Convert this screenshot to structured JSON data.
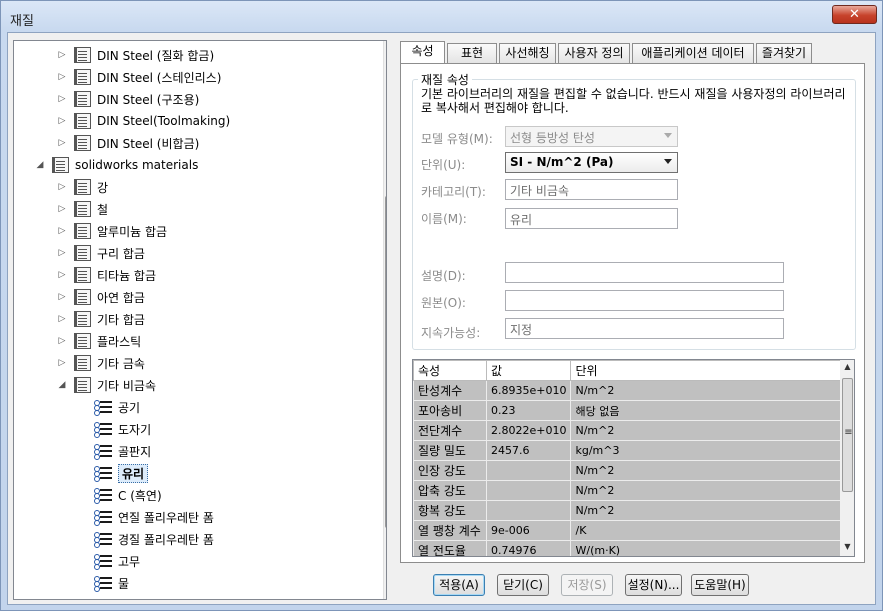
{
  "window": {
    "title": "재질",
    "close_glyph": "✕"
  },
  "tree": {
    "items": [
      {
        "label": "DIN Steel (질화 합금)",
        "kind": "folder",
        "expanded": false
      },
      {
        "label": "DIN Steel (스테인리스)",
        "kind": "folder",
        "expanded": false
      },
      {
        "label": "DIN Steel (구조용)",
        "kind": "folder",
        "expanded": false
      },
      {
        "label": "DIN Steel(Toolmaking)",
        "kind": "folder",
        "expanded": false
      },
      {
        "label": "DIN Steel (비합금)",
        "kind": "folder",
        "expanded": false
      },
      {
        "label": "solidworks materials",
        "kind": "library",
        "expanded": true
      },
      {
        "label": "강",
        "kind": "folder",
        "expanded": false
      },
      {
        "label": "철",
        "kind": "folder",
        "expanded": false
      },
      {
        "label": "알루미늄 합금",
        "kind": "folder",
        "expanded": false
      },
      {
        "label": "구리 합금",
        "kind": "folder",
        "expanded": false
      },
      {
        "label": "티타늄 합금",
        "kind": "folder",
        "expanded": false
      },
      {
        "label": "아연 합금",
        "kind": "folder",
        "expanded": false
      },
      {
        "label": "기타 합금",
        "kind": "folder",
        "expanded": false
      },
      {
        "label": "플라스틱",
        "kind": "folder",
        "expanded": false
      },
      {
        "label": "기타 금속",
        "kind": "folder",
        "expanded": false
      },
      {
        "label": "기타 비금속",
        "kind": "folder",
        "expanded": true
      },
      {
        "label": "공기",
        "kind": "material"
      },
      {
        "label": "도자기",
        "kind": "material"
      },
      {
        "label": "골판지",
        "kind": "material"
      },
      {
        "label": "유리",
        "kind": "material",
        "selected": true
      },
      {
        "label": "C (흑연)",
        "kind": "material"
      },
      {
        "label": "연질 폴리우레탄 폼",
        "kind": "material"
      },
      {
        "label": "경질 폴리우레탄 폼",
        "kind": "material"
      },
      {
        "label": "고무",
        "kind": "material"
      },
      {
        "label": "물",
        "kind": "material"
      }
    ]
  },
  "tabs": [
    "속성",
    "표현",
    "사선해칭",
    "사용자 정의",
    "애플리케이션 데이터",
    "즐겨찾기"
  ],
  "material_properties": {
    "group_title": "재질 속성",
    "notice": "기본 라이브러리의 재질을 편집할 수 없습니다. 반드시 재질을 사용자정의 라이브러리로 복사해서 편집해야 합니다.",
    "model_type_label": "모델 유형(M):",
    "model_type_value": "선형 등방성 탄성",
    "units_label": "단위(U):",
    "units_value": "SI - N/m^2 (Pa)",
    "category_label": "카테고리(T):",
    "category_value": "기타 비금속",
    "name_label": "이름(M):",
    "name_value": "유리",
    "description_label": "설명(D):",
    "description_value": "",
    "source_label": "원본(O):",
    "source_value": "",
    "sustainability_label": "지속가능성:",
    "sustainability_value": "지정"
  },
  "property_grid": {
    "columns": [
      "속성",
      "값",
      "단위"
    ],
    "rows": [
      [
        "탄성계수",
        "6.8935e+010",
        "N/m^2"
      ],
      [
        "포아송비",
        "0.23",
        "해당 없음"
      ],
      [
        "전단계수",
        "2.8022e+010",
        "N/m^2"
      ],
      [
        "질량 밀도",
        "2457.6",
        "kg/m^3"
      ],
      [
        "인장 강도",
        "",
        "N/m^2"
      ],
      [
        "압축 강도",
        "",
        "N/m^2"
      ],
      [
        "항복 강도",
        "",
        "N/m^2"
      ],
      [
        "열 팽창 계수",
        "9e-006",
        "/K"
      ],
      [
        "열 전도율",
        "0.74976",
        "W/(m·K)"
      ]
    ]
  },
  "buttons": {
    "apply": "적용(A)",
    "close": "닫기(C)",
    "save": "저장(S)",
    "config": "설정(N)...",
    "help": "도움말(H)"
  },
  "scroll_glyphs": {
    "up": "▲",
    "down": "▼",
    "grip": "≡"
  }
}
